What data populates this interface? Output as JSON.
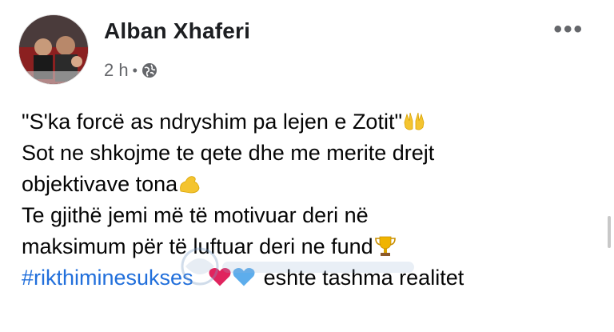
{
  "post": {
    "author": "Alban Xhaferi",
    "time": "2 h",
    "separator": "•",
    "privacy_icon": "globe-icon",
    "more_label": "•••",
    "lines": [
      "\"S'ka forcë as ndryshim pa lejen e Zotit\"",
      "Sot ne shkojme te qete dhe me merite drejt",
      "objektivave tona",
      "Te gjithë jemi më të motivuar deri në",
      "maksimum për të luftuar deri ne fund"
    ],
    "hashtag": "#rikthiminesukses",
    "closing": "eshte tashma realitet",
    "emojis": [
      "raising-hands-emoji",
      "flexed-biceps-emoji",
      "trophy-emoji",
      "red-heart-emoji",
      "blue-heart-emoji"
    ]
  },
  "colors": {
    "hashtag": "#216fdb",
    "meta": "#65676b",
    "text": "#050505"
  }
}
